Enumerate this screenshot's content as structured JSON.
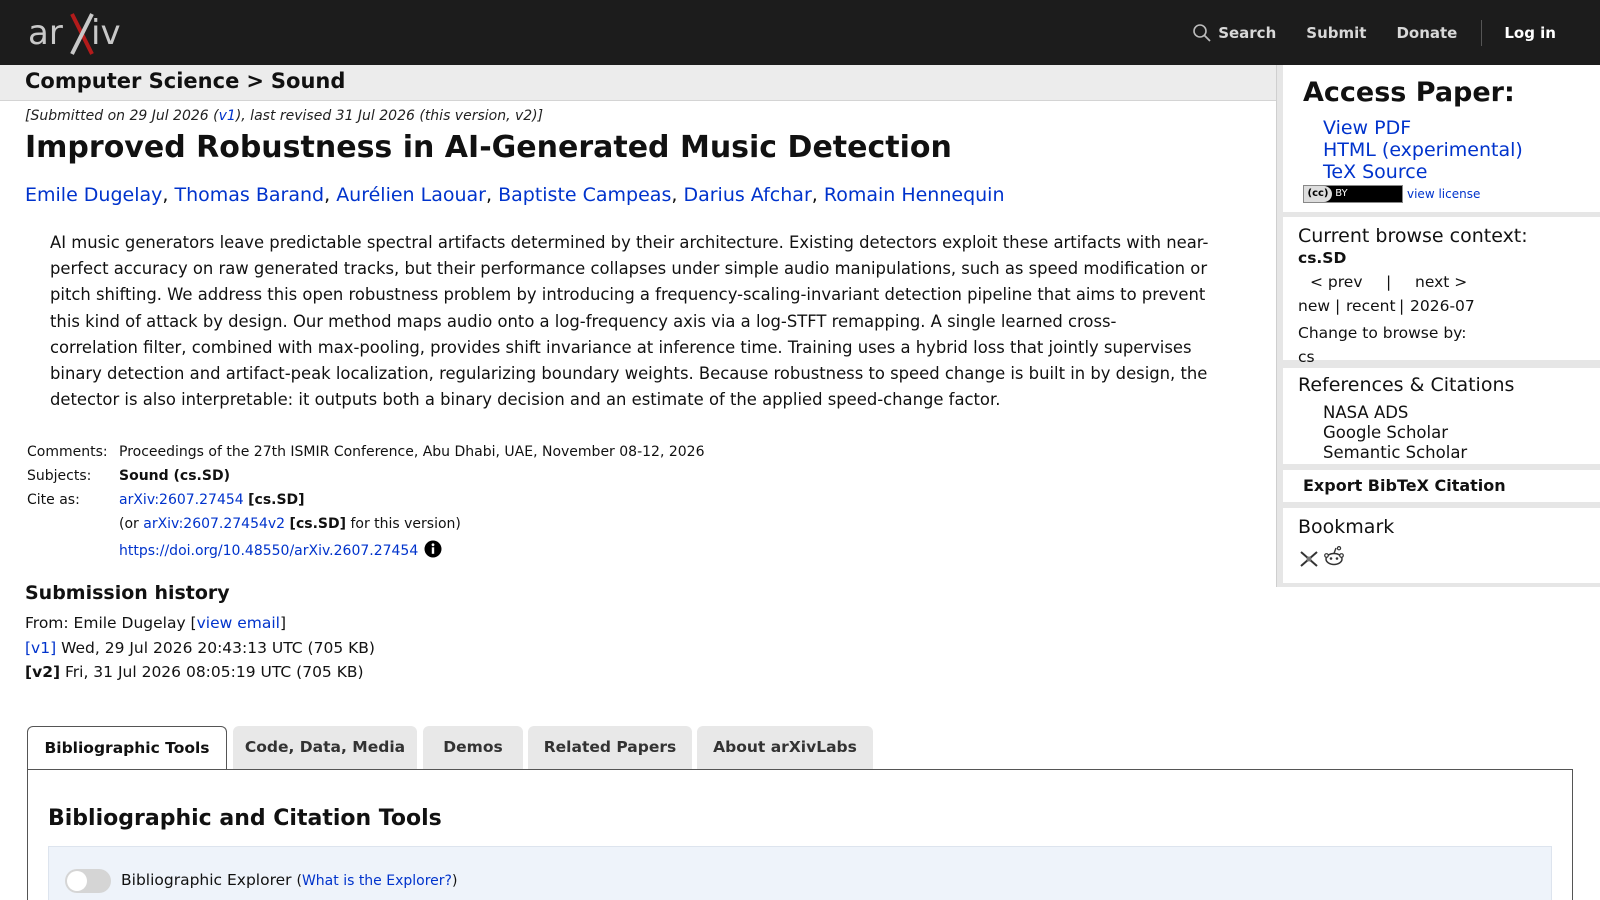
{
  "header": {
    "logo_text": "arXiv",
    "nav": {
      "search": "Search",
      "submit": "Submit",
      "donate": "Donate",
      "login": "Log in"
    }
  },
  "breadcrumb": {
    "section": "Computer Science",
    "separator": ">",
    "category": "Sound"
  },
  "paper": {
    "dateline_prefix": "[Submitted on 29 Jul 2026 (",
    "dateline_v1": "v1",
    "dateline_suffix": "), last revised 31 Jul 2026 (this version, v2)]",
    "title": "Improved Robustness in AI-Generated Music Detection",
    "authors": [
      "Emile Dugelay",
      "Thomas Barand",
      "Aurélien Laouar",
      "Baptiste Campeas",
      "Darius Afchar",
      "Romain Hennequin"
    ],
    "abstract_lines": [
      "AI music generators leave predictable spectral artifacts determined by their architecture. Existing detectors exploit these artifacts with near-",
      "perfect accuracy on raw generated tracks, but their performance collapses under simple audio manipulations, such as speed modification or",
      "pitch shifting. We address this open robustness problem by introducing a frequency-scaling-invariant detection pipeline that aims to prevent",
      "this kind of attack by design. Our method maps audio onto a log-frequency axis via a log-STFT remapping. A single learned cross-",
      "correlation filter, combined with max-pooling, provides shift invariance at inference time. Training uses a hybrid loss that jointly supervises",
      "binary detection and artifact-peak localization, regularizing boundary weights. Because robustness to speed change is built in by design, the",
      "detector is also interpretable: it outputs both a binary decision and an estimate of the applied speed-change factor."
    ],
    "comments_label": "Comments:",
    "comments": "Proceedings of the 27th ISMIR Conference, Abu Dhabi, UAE, November 08-12, 2026",
    "subjects_label": "Subjects:",
    "subjects": "Sound (cs.SD)",
    "cite_label": "Cite as:",
    "cite_id": "arXiv:2607.27454",
    "cite_cat": "[cs.SD]",
    "cite_or_prefix": "(or ",
    "cite_version_id": "arXiv:2607.27454v2",
    "cite_or_suffix": " for this version)",
    "doi": "https://doi.org/10.48550/arXiv.2607.27454"
  },
  "history": {
    "heading": "Submission history",
    "from_prefix": "From: Emile Dugelay [",
    "view_email": "view email",
    "from_suffix": "]",
    "versions": [
      {
        "tag": "[v1]",
        "text": " Wed, 29 Jul 2026 20:43:13 UTC (705 KB)"
      },
      {
        "tag": "[v2]",
        "text": " Fri, 31 Jul 2026 08:05:19 UTC (705 KB)"
      }
    ]
  },
  "tabs": [
    {
      "label": "Bibliographic Tools",
      "active": true
    },
    {
      "label": "Code, Data, Media",
      "active": false
    },
    {
      "label": "Demos",
      "active": false
    },
    {
      "label": "Related Papers",
      "active": false
    },
    {
      "label": "About arXivLabs",
      "active": false
    }
  ],
  "tab_panel": {
    "heading": "Bibliographic and Citation Tools",
    "explorer_label": "Bibliographic Explorer",
    "explorer_help": "What is the Explorer?",
    "explorer_enabled": false
  },
  "sidebar": {
    "access_heading": "Access Paper:",
    "access_links": [
      "View PDF",
      "HTML (experimental)",
      "TeX Source"
    ],
    "license_badge": "BY",
    "license_cc": "(cc)",
    "view_license": "view license",
    "browse_heading": "Current browse context:",
    "browse_context": "cs.SD",
    "prev": "< prev",
    "pipe": "|",
    "next": "next >",
    "new": "new",
    "recent": "recent",
    "month": "2026-07",
    "change_browse": "Change to browse by:",
    "browse_cs": "cs",
    "refs_heading": "References & Citations",
    "refs_links": [
      "NASA ADS",
      "Google Scholar",
      "Semantic Scholar"
    ],
    "export_bibtex": "Export BibTeX Citation",
    "bookmark_heading": "Bookmark",
    "bookmark_icons": [
      "bibsonomy-icon",
      "reddit-icon"
    ]
  },
  "colors": {
    "topbar": "#1c1c1c",
    "link": "#0033cc",
    "logo_x": "#b31b1b"
  }
}
